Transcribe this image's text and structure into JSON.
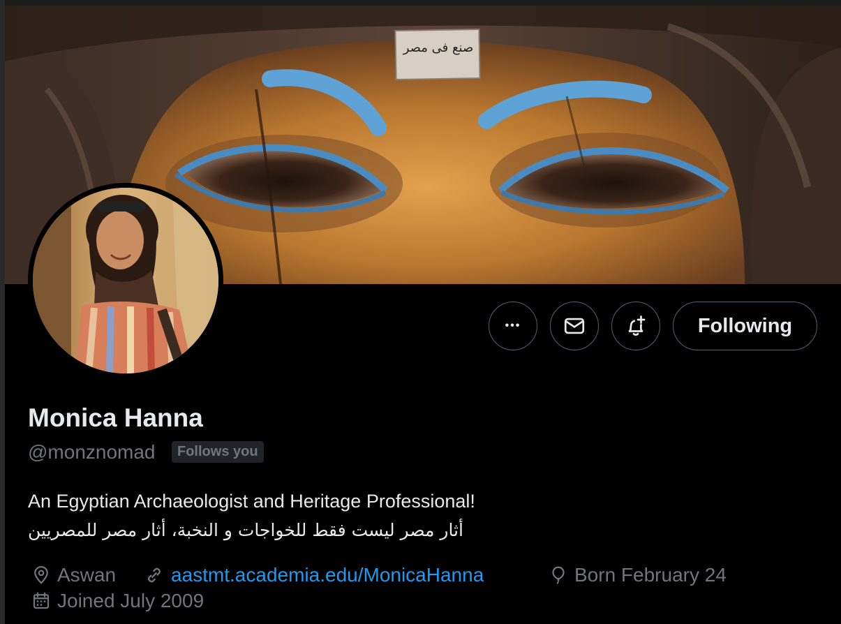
{
  "banner": {
    "sign_text": "صنع فى مصر"
  },
  "actions": {
    "more_label": "•••",
    "following_label": "Following"
  },
  "profile": {
    "name": "Monica Hanna",
    "handle": "@monznomad",
    "follows_you_badge": "Follows you",
    "bio_line1": "An Egyptian Archaeologist and Heritage Professional!",
    "bio_line2": "أثار مصر ليست فقط للخواجات و النخبة، أثار مصر للمصريين",
    "location": "Aswan",
    "website": "aastmt.academia.edu/MonicaHanna",
    "born": "Born February 24",
    "joined": "Joined July 2009"
  },
  "icons": {
    "more": "more-horizontal-icon",
    "message": "envelope-icon",
    "notify": "bell-plus-icon",
    "location": "map-pin-icon",
    "link": "link-icon",
    "birthday": "balloon-icon",
    "joined": "calendar-icon"
  },
  "colors": {
    "link": "#1d9bf0",
    "muted": "#71767b",
    "border": "#536471",
    "text": "#e7e9ea",
    "background": "#000000"
  }
}
